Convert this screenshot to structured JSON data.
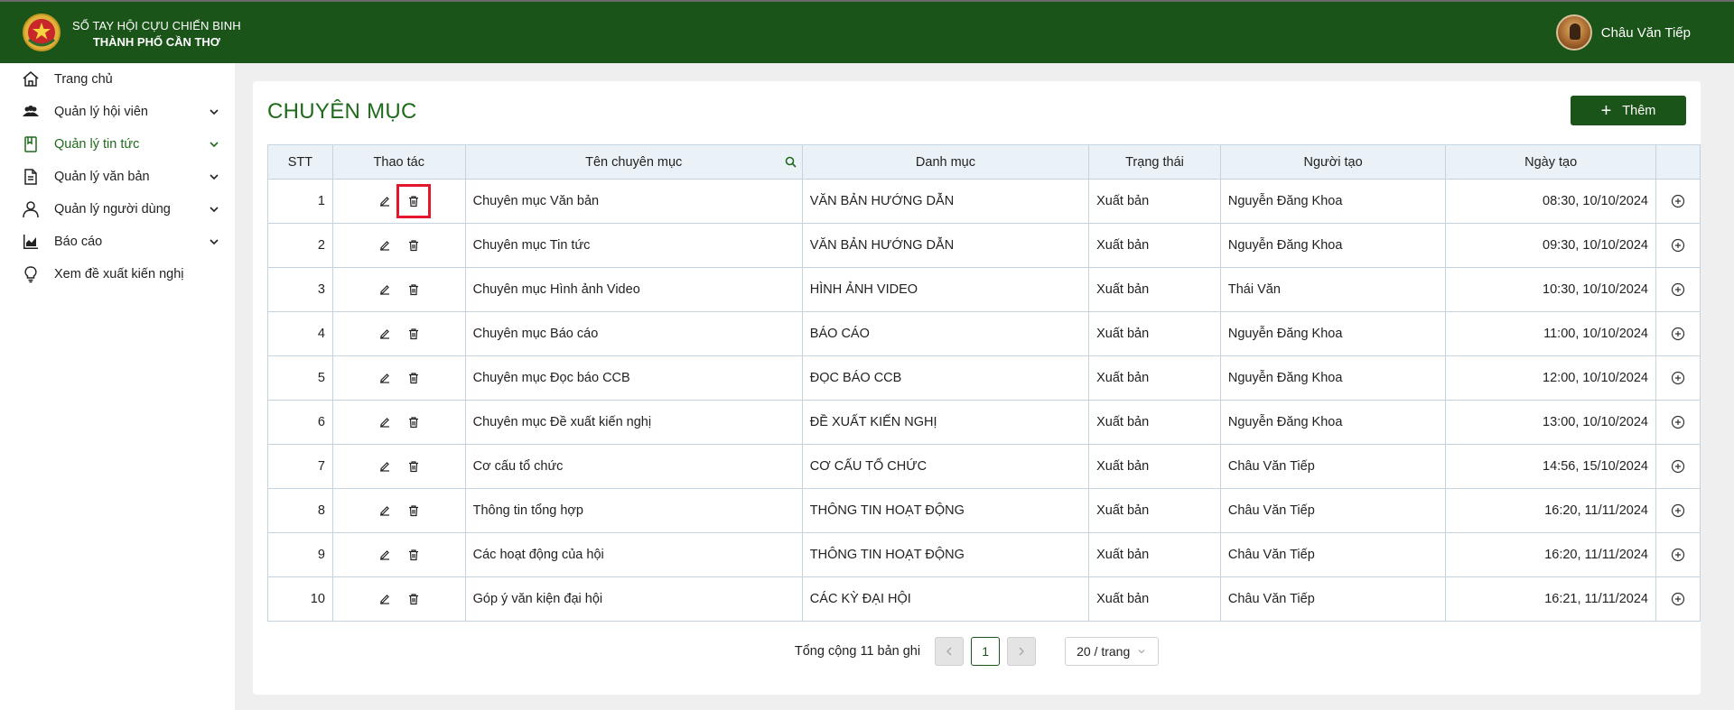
{
  "header": {
    "brand_line1": "SỔ TAY HỘI CỰU CHIẾN BINH",
    "brand_line2": "THÀNH PHỐ CẦN THƠ",
    "user_name": "Châu Văn Tiếp",
    "bg_color": "#1a5418"
  },
  "sidebar": {
    "items": [
      {
        "label": "Trang chủ",
        "icon": "home-icon"
      },
      {
        "label": "Quản lý hội viên",
        "icon": "users-icon"
      },
      {
        "label": "Quản lý tin tức",
        "icon": "bookmark-icon"
      },
      {
        "label": "Quản lý văn bản",
        "icon": "document-icon"
      },
      {
        "label": "Quản lý người dùng",
        "icon": "user-icon"
      },
      {
        "label": "Báo cáo",
        "icon": "chart-icon"
      },
      {
        "label": "Xem đề xuất kiến nghị",
        "icon": "bulb-icon"
      }
    ]
  },
  "page": {
    "title": "CHUYÊN MỤC",
    "add_label": "Thêm"
  },
  "table": {
    "headers": {
      "stt": "STT",
      "actions": "Thao tác",
      "name": "Tên chuyên mục",
      "category": "Danh mục",
      "status": "Trạng thái",
      "creator": "Người tạo",
      "created": "Ngày tạo"
    },
    "rows": [
      {
        "stt": "1",
        "name": "Chuyên mục Văn bản",
        "category": "VĂN BẢN HƯỚNG DẪN",
        "status": "Xuất bản",
        "creator": "Nguyễn Đăng Khoa",
        "created": "08:30, 10/10/2024"
      },
      {
        "stt": "2",
        "name": "Chuyên mục Tin tức",
        "category": "VĂN BẢN HƯỚNG DẪN",
        "status": "Xuất bản",
        "creator": "Nguyễn Đăng Khoa",
        "created": "09:30, 10/10/2024"
      },
      {
        "stt": "3",
        "name": "Chuyên mục Hình ảnh Video",
        "category": "HÌNH ẢNH VIDEO",
        "status": "Xuất bản",
        "creator": "Thái Văn",
        "created": "10:30, 10/10/2024"
      },
      {
        "stt": "4",
        "name": "Chuyên mục Báo cáo",
        "category": "BÁO CÁO",
        "status": "Xuất bản",
        "creator": "Nguyễn Đăng Khoa",
        "created": "11:00, 10/10/2024"
      },
      {
        "stt": "5",
        "name": "Chuyên mục Đọc báo CCB",
        "category": "ĐỌC BÁO CCB",
        "status": "Xuất bản",
        "creator": "Nguyễn Đăng Khoa",
        "created": "12:00, 10/10/2024"
      },
      {
        "stt": "6",
        "name": "Chuyên mục Đề xuất kiến nghị",
        "category": "ĐỀ XUẤT KIẾN NGHỊ",
        "status": "Xuất bản",
        "creator": "Nguyễn Đăng Khoa",
        "created": "13:00, 10/10/2024"
      },
      {
        "stt": "7",
        "name": "Cơ cấu tổ chức",
        "category": "CƠ CẤU TỔ CHỨC",
        "status": "Xuất bản",
        "creator": "Châu Văn Tiếp",
        "created": "14:56, 15/10/2024"
      },
      {
        "stt": "8",
        "name": "Thông tin tổng hợp",
        "category": "THÔNG TIN HOẠT ĐỘNG",
        "status": "Xuất bản",
        "creator": "Châu Văn Tiếp",
        "created": "16:20, 11/11/2024"
      },
      {
        "stt": "9",
        "name": "Các hoạt động của hội",
        "category": "THÔNG TIN HOẠT ĐỘNG",
        "status": "Xuất bản",
        "creator": "Châu Văn Tiếp",
        "created": "16:20, 11/11/2024"
      },
      {
        "stt": "10",
        "name": "Góp ý văn kiện đại hội",
        "category": "CÁC KỲ ĐẠI HỘI",
        "status": "Xuất bản",
        "creator": "Châu Văn Tiếp",
        "created": "16:21, 11/11/2024"
      }
    ]
  },
  "pagination": {
    "total": "Tổng cộng 11 bản ghi",
    "current_page": "1",
    "page_size": "20 / trang"
  },
  "colors": {
    "accent": "#1f6a1b",
    "highlight": "#e3162b"
  }
}
